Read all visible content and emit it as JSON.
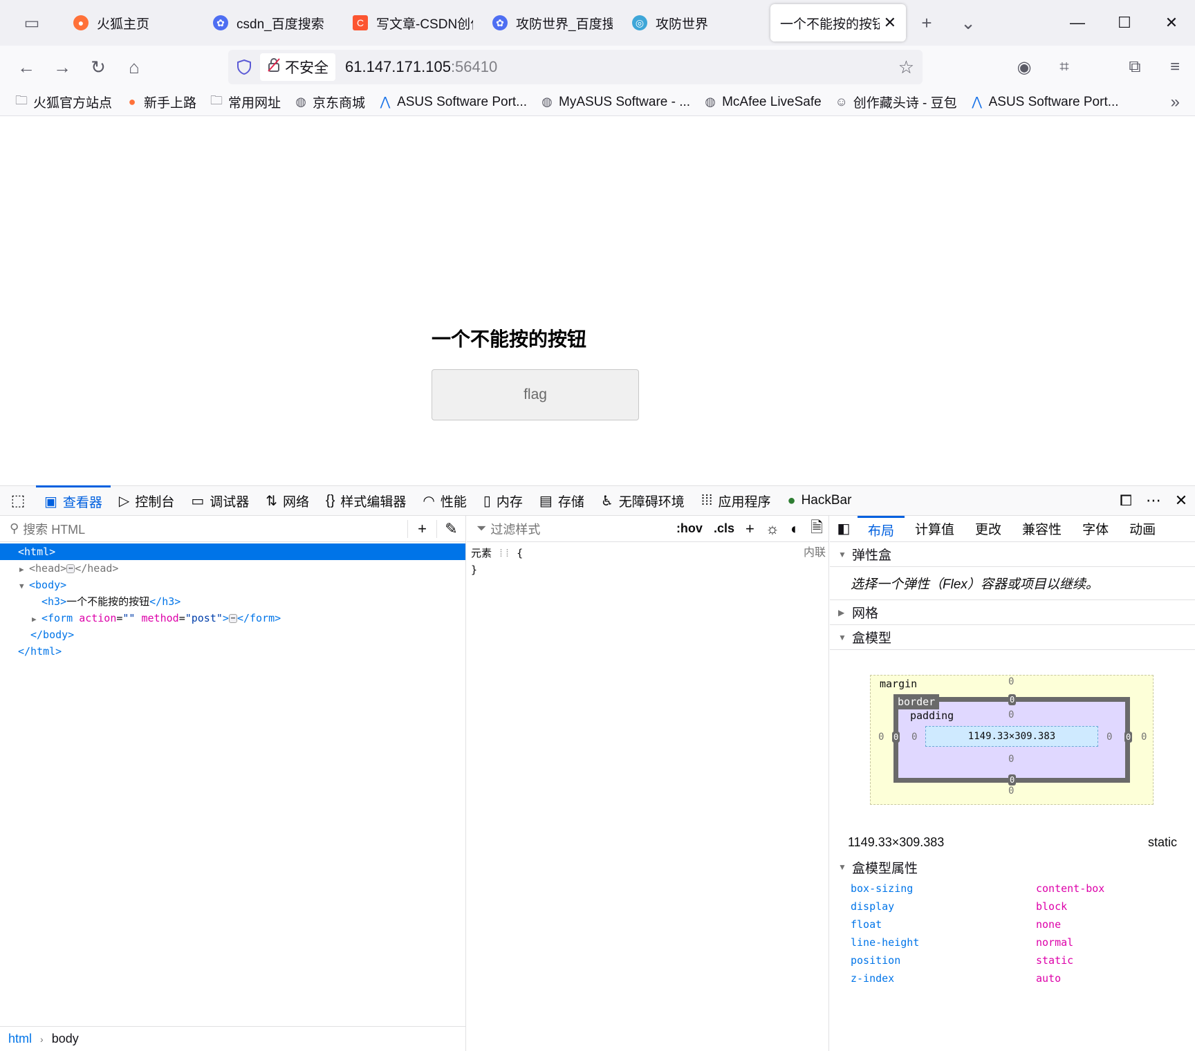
{
  "tabs": [
    {
      "title": "火狐主页",
      "icon": "firefox-icon",
      "color": "#ff7139"
    },
    {
      "title": "csdn_百度搜索",
      "icon": "baidu-icon",
      "color": "#4e6ef2"
    },
    {
      "title": "写文章-CSDN创作中心",
      "icon": "csdn-icon",
      "color": "#fc5531"
    },
    {
      "title": "攻防世界_百度搜索",
      "icon": "baidu-icon",
      "color": "#4e6ef2"
    },
    {
      "title": "攻防世界",
      "icon": "globe-icon",
      "color": "#3ea6d8"
    },
    {
      "title": "一个不能按的按钮",
      "icon": "",
      "color": "",
      "active": true
    }
  ],
  "navbar": {
    "security_label": "不安全",
    "url_host": "61.147.171.105",
    "url_port": ":56410"
  },
  "bookmarks": [
    {
      "label": "火狐官方站点",
      "icon": "folder-icon"
    },
    {
      "label": "新手上路",
      "icon": "firefox-icon"
    },
    {
      "label": "常用网址",
      "icon": "folder-icon"
    },
    {
      "label": "京东商城",
      "icon": "globe-icon"
    },
    {
      "label": "ASUS Software Port...",
      "icon": "asus-icon"
    },
    {
      "label": "MyASUS Software - ...",
      "icon": "globe-icon"
    },
    {
      "label": "McAfee LiveSafe",
      "icon": "globe-icon"
    },
    {
      "label": "创作藏头诗 - 豆包",
      "icon": "doubao-icon"
    },
    {
      "label": "ASUS Software Port...",
      "icon": "asus-icon"
    }
  ],
  "page": {
    "heading": "一个不能按的按钮",
    "button_label": "flag"
  },
  "devtools": {
    "tabs": [
      {
        "label": "查看器",
        "icon": "inspector-icon",
        "active": true
      },
      {
        "label": "控制台",
        "icon": "console-icon"
      },
      {
        "label": "调试器",
        "icon": "debugger-icon"
      },
      {
        "label": "网络",
        "icon": "network-icon"
      },
      {
        "label": "样式编辑器",
        "icon": "style-editor-icon"
      },
      {
        "label": "性能",
        "icon": "performance-icon"
      },
      {
        "label": "内存",
        "icon": "memory-icon"
      },
      {
        "label": "存储",
        "icon": "storage-icon"
      },
      {
        "label": "无障碍环境",
        "icon": "accessibility-icon"
      },
      {
        "label": "应用程序",
        "icon": "application-icon"
      },
      {
        "label": "HackBar",
        "icon": "hackbar-icon"
      }
    ],
    "search_placeholder": "搜索 HTML",
    "markup": {
      "html_open": "<html>",
      "head_open": "<head>",
      "head_close": "</head>",
      "body_open": "<body>",
      "h3_open": "<h3>",
      "h3_text": "一个不能按的按钮",
      "h3_close": "</h3>",
      "form_tag": "<form",
      "form_attr1_name": "action",
      "form_attr1_value": "\"\"",
      "form_attr2_name": "method",
      "form_attr2_value": "\"post\"",
      "form_close": "</form>",
      "body_close": "</body>",
      "html_close": "</html>"
    },
    "breadcrumbs": [
      "html",
      "body"
    ],
    "rules": {
      "filter_placeholder": "过滤样式",
      "hov": ":hov",
      "cls": ".cls",
      "selector": "元素",
      "open_brace": "{",
      "close_brace": "}",
      "inline_label": "内联"
    },
    "layout": {
      "tabs": [
        "布局",
        "计算值",
        "更改",
        "兼容性",
        "字体",
        "动画"
      ],
      "flexbox_title": "弹性盒",
      "flexbox_msg": "选择一个弹性（Flex）容器或项目以继续。",
      "grid_title": "网格",
      "boxmodel_title": "盒模型",
      "margin_label": "margin",
      "border_label": "border",
      "padding_label": "padding",
      "content_size": "1149.33×309.383",
      "zero": "0",
      "dims": "1149.33×309.383",
      "position": "static",
      "props_title": "盒模型属性",
      "props": [
        {
          "name": "box-sizing",
          "value": "content-box"
        },
        {
          "name": "display",
          "value": "block"
        },
        {
          "name": "float",
          "value": "none"
        },
        {
          "name": "line-height",
          "value": "normal"
        },
        {
          "name": "position",
          "value": "static"
        },
        {
          "name": "z-index",
          "value": "auto"
        }
      ]
    }
  }
}
